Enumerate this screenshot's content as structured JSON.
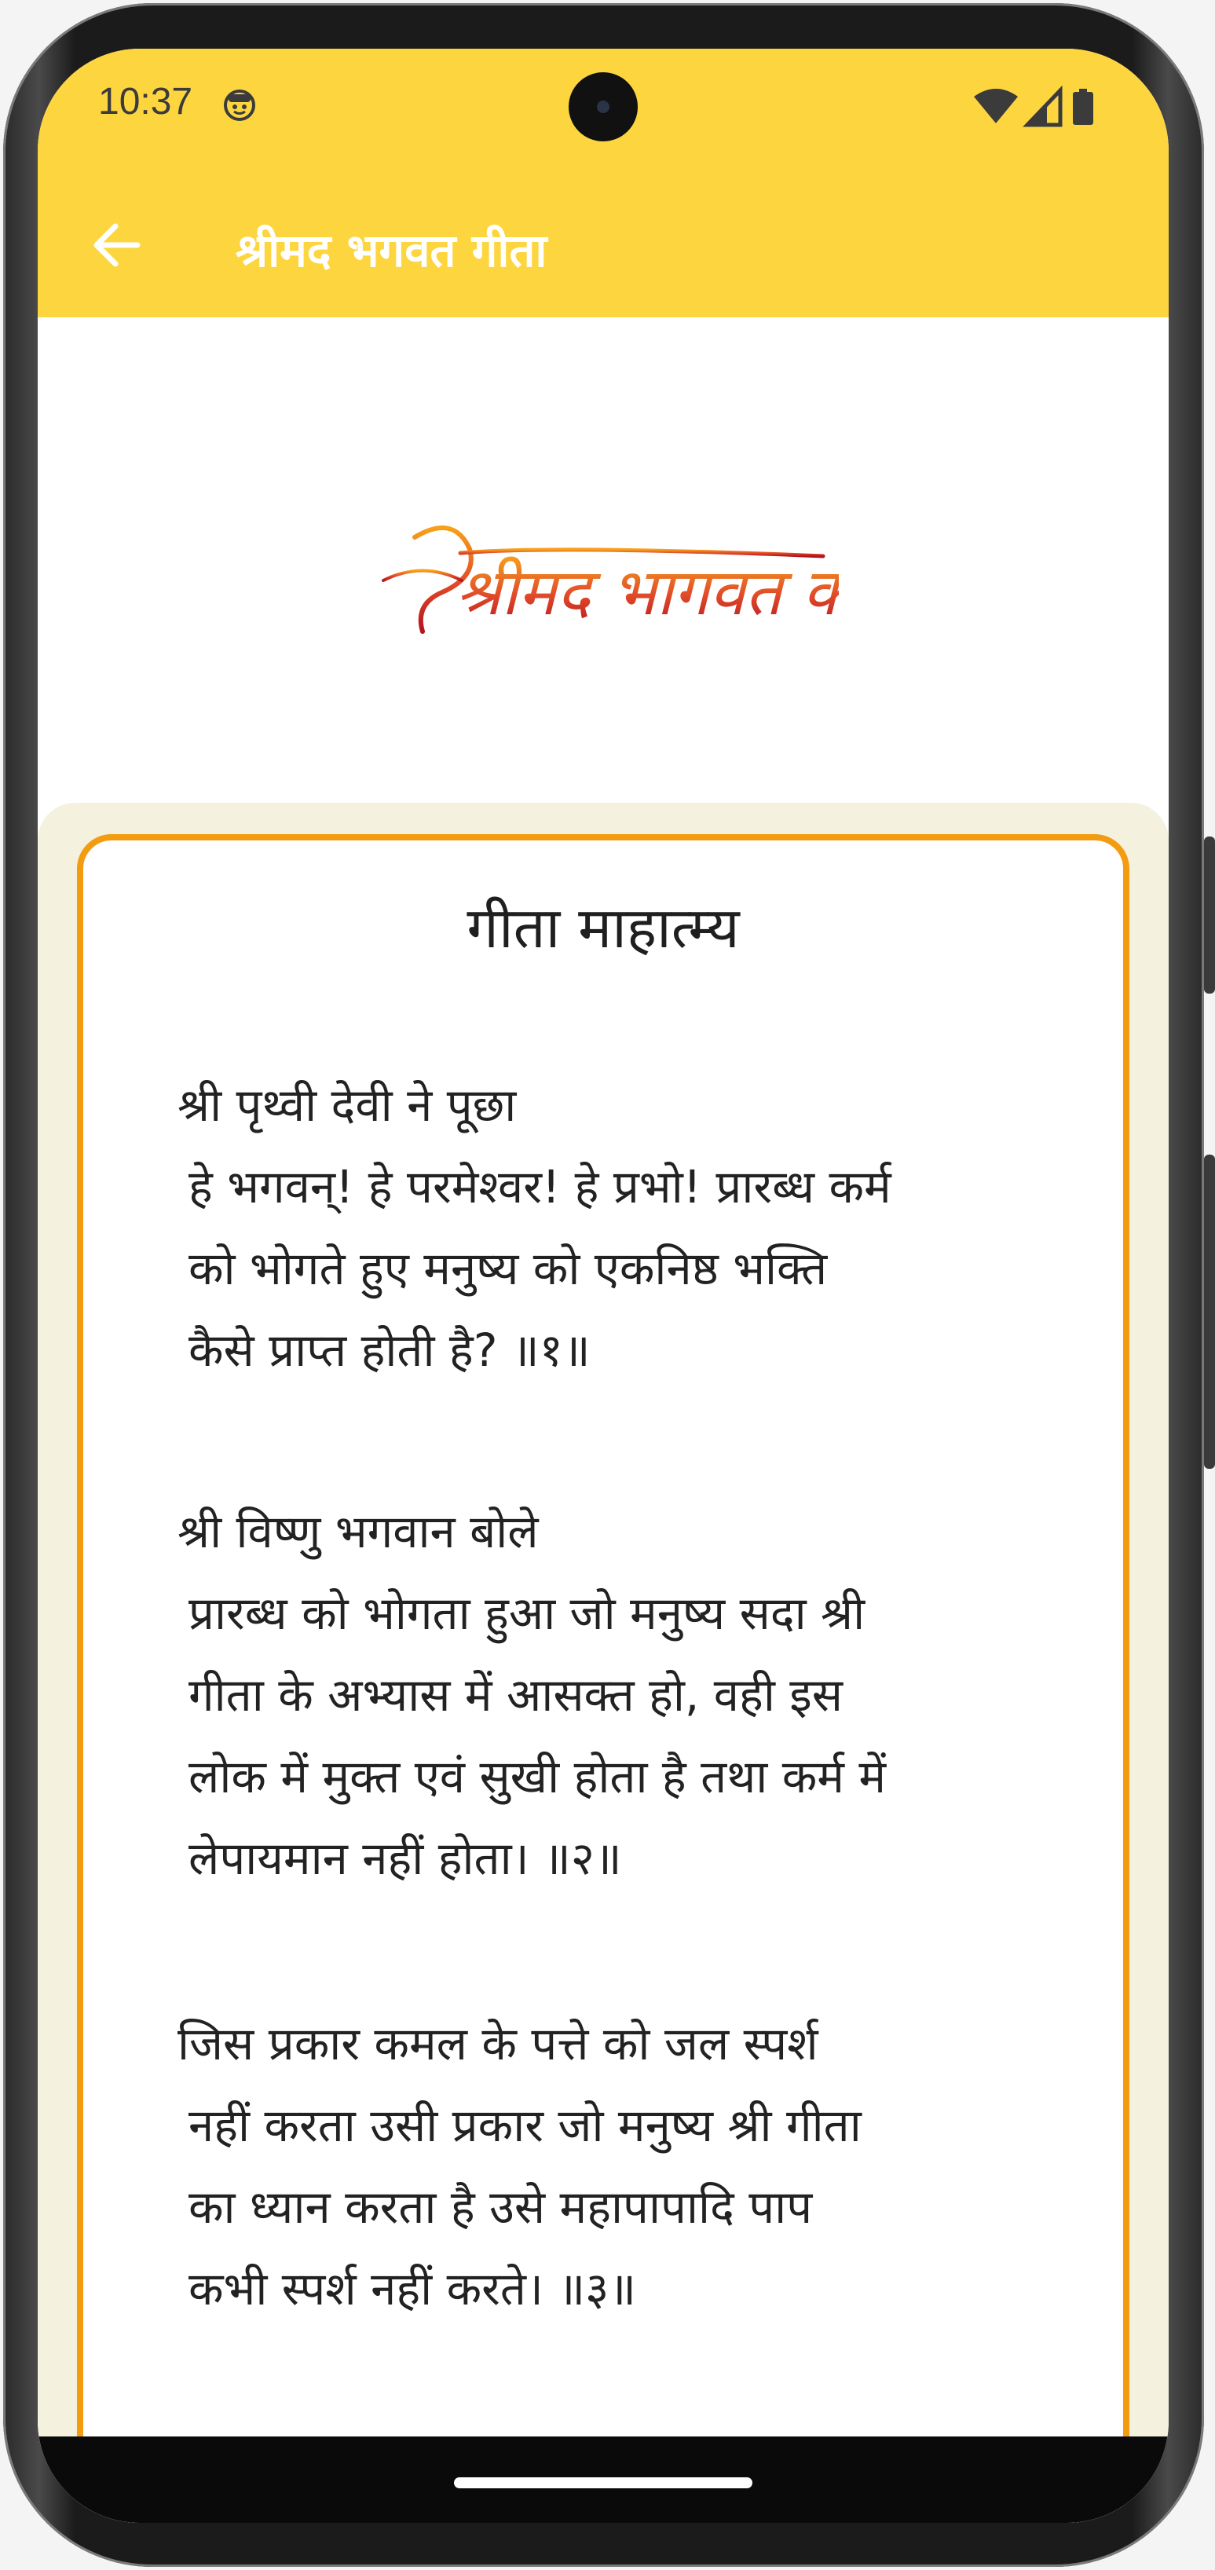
{
  "status_bar": {
    "time": "10:37",
    "notification_icon": "smiley-face-icon",
    "icons": [
      "wifi-icon",
      "signal-icon",
      "battery-icon"
    ]
  },
  "app_bar": {
    "back_icon": "arrow-left-icon",
    "title": "श्रीमद भगवत गीता",
    "background_color": "#fdd63f",
    "title_color": "#ffffff"
  },
  "banner": {
    "logo_text": "श्रीमद भागवत कथा",
    "logo_color": "#e0482a"
  },
  "card": {
    "title": "गीता माहात्म्य",
    "border_color": "#f39c12",
    "verses": [
      {
        "speaker": "श्री पृथ्वी देवी ने पूछा",
        "lines": [
          "हे भगवन्! हे परमेश्वर! हे प्रभो! प्रारब्ध कर्म",
          "को भोगते हुए मनुष्य को एकनिष्ठ भक्ति",
          "कैसे प्राप्त होती है? ॥१॥"
        ]
      },
      {
        "speaker": "श्री विष्णु भगवान बोले",
        "lines": [
          "प्रारब्ध को भोगता हुआ जो मनुष्य सदा श्री",
          "गीता के अभ्यास में आसक्त हो, वही इस",
          "लोक में मुक्त एवं सुखी होता है तथा कर्म में",
          "लेपायमान नहीं होता। ॥२॥"
        ]
      },
      {
        "speaker": "जिस प्रकार कमल के पत्ते को जल स्पर्श",
        "lines": [
          "नहीं करता उसी प्रकार जो मनुष्य श्री गीता",
          "का ध्यान करता है उसे महापापादि पाप",
          "कभी स्पर्श नहीं करते। ॥३॥"
        ]
      }
    ]
  }
}
